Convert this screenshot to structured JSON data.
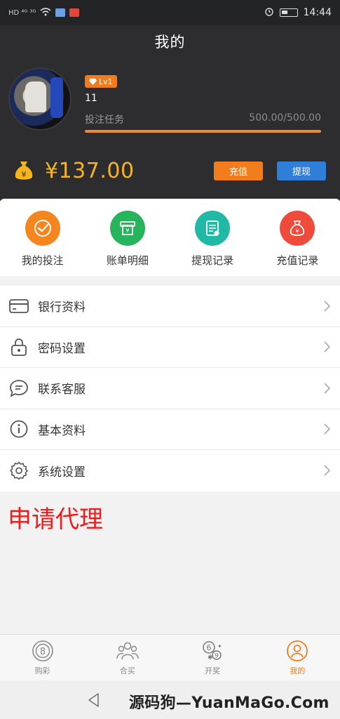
{
  "status_bar": {
    "network": "HD ⁴ᴳ ³ᴳ",
    "time": "14:44"
  },
  "header": {
    "title": "我的"
  },
  "profile": {
    "level_badge": "Lv1",
    "username": "11",
    "task_label": "投注任务",
    "task_progress_text": "500.00/500.00",
    "task_progress_fraction": 1.0
  },
  "wallet": {
    "balance": "¥137.00",
    "recharge_label": "充值",
    "withdraw_label": "提现"
  },
  "quick_actions": [
    {
      "label": "我的投注",
      "icon": "checkmark-icon",
      "color": "#f5851f"
    },
    {
      "label": "账单明细",
      "icon": "bill-icon",
      "color": "#27b45c"
    },
    {
      "label": "提现记录",
      "icon": "record-icon",
      "color": "#1fb9a6"
    },
    {
      "label": "充值记录",
      "icon": "money-bag-icon",
      "color": "#ef4b3a"
    }
  ],
  "menu": [
    {
      "label": "银行资料",
      "icon": "bank-card-icon"
    },
    {
      "label": "密码设置",
      "icon": "lock-icon"
    },
    {
      "label": "联系客服",
      "icon": "chat-icon"
    },
    {
      "label": "基本资料",
      "icon": "info-icon"
    },
    {
      "label": "系统设置",
      "icon": "gear-icon"
    }
  ],
  "agent_link": "申请代理",
  "tabs": [
    {
      "label": "购彩",
      "icon": "lottery-ball-icon",
      "active": false
    },
    {
      "label": "合买",
      "icon": "group-icon",
      "active": false
    },
    {
      "label": "开奖",
      "icon": "draw-numbers-icon",
      "active": false
    },
    {
      "label": "我的",
      "icon": "profile-icon",
      "active": true
    }
  ],
  "watermark": "源码狗—YuanMaGo.Com",
  "colors": {
    "accent": "#f07c1e",
    "header_bg": "#2d2d30",
    "balance": "#f6b51c",
    "agent": "#f21b1b"
  }
}
